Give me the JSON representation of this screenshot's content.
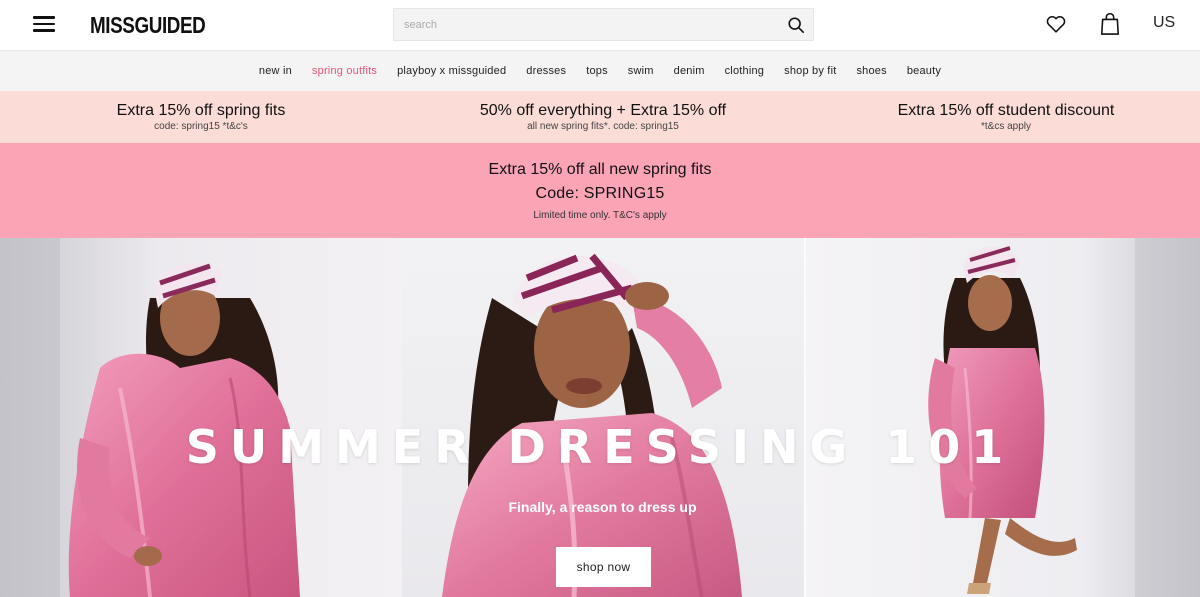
{
  "header": {
    "logo": "MISSGUIDED",
    "search_placeholder": "search",
    "region": "US"
  },
  "nav": {
    "items": [
      {
        "label": "new in"
      },
      {
        "label": "spring outfits"
      },
      {
        "label": "playboy x missguided"
      },
      {
        "label": "dresses"
      },
      {
        "label": "tops"
      },
      {
        "label": "swim"
      },
      {
        "label": "denim"
      },
      {
        "label": "clothing"
      },
      {
        "label": "shop by fit"
      },
      {
        "label": "shoes"
      },
      {
        "label": "beauty"
      }
    ],
    "active_index": 1
  },
  "promos": [
    {
      "title": "Extra 15% off spring fits",
      "subtitle": "code: spring15 *t&c's"
    },
    {
      "title": "50% off everything + Extra 15% off",
      "subtitle": "all new spring fits*. code: spring15"
    },
    {
      "title": "Extra 15% off student discount",
      "subtitle": "*t&cs apply"
    }
  ],
  "banner": {
    "title": "Extra 15% off all new spring fits",
    "code": "Code: SPRING15",
    "note": "Limited time only. T&C's apply"
  },
  "hero": {
    "title": "SUMMER DRESSING 101",
    "subtitle": "Finally, a reason to dress up",
    "cta": "shop now"
  },
  "colors": {
    "accent": "#e8547b",
    "promo_strip_bg": "#fcdcd7",
    "banner_bg": "#fba4b6",
    "nav_bg": "#f4f4f4",
    "outfit_pink": "#e27a9f"
  },
  "icons": {
    "menu": "hamburger-icon",
    "search": "search-icon",
    "wishlist": "heart-icon",
    "cart": "bag-icon"
  }
}
